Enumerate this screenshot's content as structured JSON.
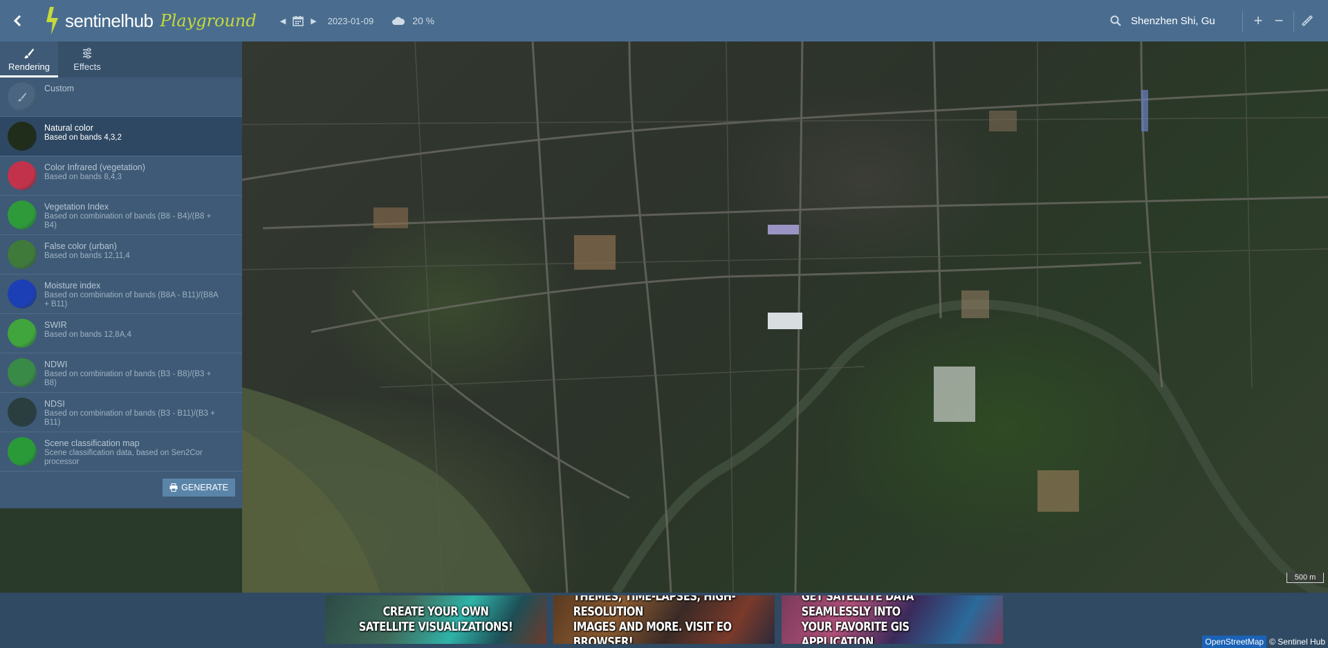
{
  "app": {
    "logo_text": "sentinelhub",
    "logo_sub": "Playground",
    "date": "2023-01-09",
    "cloud": "20 %",
    "search_value": "Shenzhen Shi, Gu",
    "zoom_in": "+",
    "zoom_out": "−"
  },
  "tabs": [
    {
      "label": "Rendering",
      "icon": "brush-icon",
      "active": true
    },
    {
      "label": "Effects",
      "icon": "sliders-icon",
      "active": false
    }
  ],
  "layers": [
    {
      "name": "Custom",
      "desc": "",
      "color": "#4b6580",
      "active": false
    },
    {
      "name": "Natural color",
      "desc": "Based on bands 4,3,2",
      "color": "#1f2d1a",
      "active": true
    },
    {
      "name": "Color Infrared (vegetation)",
      "desc": "Based on bands 8,4,3",
      "color": "#c2324a",
      "active": false
    },
    {
      "name": "Vegetation Index",
      "desc": "Based on combination of bands (B8 - B4)/(B8 + B4)",
      "color": "#2f9a3a",
      "active": false
    },
    {
      "name": "False color (urban)",
      "desc": "Based on bands 12,11,4",
      "color": "#3f7a3a",
      "active": false
    },
    {
      "name": "Moisture index",
      "desc": "Based on combination of bands (B8A - B11)/(B8A + B11)",
      "color": "#1d3fb5",
      "active": false
    },
    {
      "name": "SWIR",
      "desc": "Based on bands 12,8A,4",
      "color": "#3fa53c",
      "active": false
    },
    {
      "name": "NDWI",
      "desc": "Based on combination of bands (B3 - B8)/(B3 + B8)",
      "color": "#3a8a47",
      "active": false
    },
    {
      "name": "NDSI",
      "desc": "Based on combination of bands (B3 - B11)/(B3 + B11)",
      "color": "#2a3e40",
      "active": false
    },
    {
      "name": "Scene classification map",
      "desc": "Scene classification data, based on Sen2Cor processor",
      "color": "#2a9a38",
      "active": false
    }
  ],
  "generate_label": "GENERATE",
  "map": {
    "scale": "500 m"
  },
  "banners": [
    {
      "line1": "CREATE YOUR OWN",
      "line2": "SATELLITE VISUALIZATIONS!"
    },
    {
      "line1": "THEMES, TIME-LAPSES, HIGH-RESOLUTION",
      "line2": "IMAGES AND MORE. VISIT EO BROWSER!"
    },
    {
      "line1": "GET SATELLITE DATA SEAMLESSLY INTO",
      "line2": "YOUR FAVORITE GIS APPLICATION"
    }
  ],
  "attribution": {
    "osm": "OpenStreetMap",
    "sh": "© Sentinel Hub"
  }
}
